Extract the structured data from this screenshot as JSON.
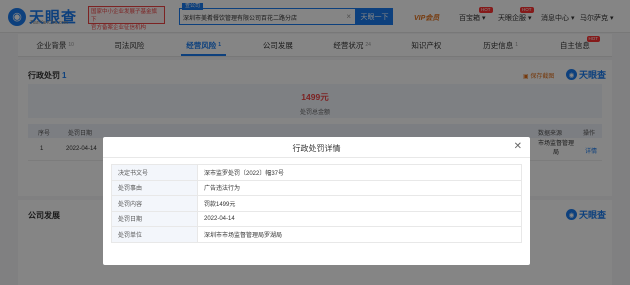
{
  "header": {
    "logo_text": "天眼查",
    "logo_url": "TianYanCha.com",
    "promo_line1": "国家中小企业发展子基金旗下",
    "promo_line2": "官方备案企业征信机构",
    "search_tag": "查公司",
    "search_value": "深圳市美肴餐饮管理有限公司百花二路分店",
    "search_button": "天眼一下",
    "vip_label": "VIP会员",
    "nav_app": "百宝箱",
    "nav_services": "天眼企服",
    "nav_messages": "消息中心",
    "nav_user": "马尔萨克",
    "hot": "HOT"
  },
  "tabs": [
    {
      "label": "企业背景",
      "count": "10"
    },
    {
      "label": "司法风险",
      "count": ""
    },
    {
      "label": "经营风险",
      "count": "1"
    },
    {
      "label": "公司发展",
      "count": ""
    },
    {
      "label": "经营状况",
      "count": "24"
    },
    {
      "label": "知识产权",
      "count": ""
    },
    {
      "label": "历史信息",
      "count": "1"
    },
    {
      "label": "自主信息",
      "count": ""
    }
  ],
  "penalty": {
    "title": "行政处罚",
    "count": "1",
    "save_label": "保存截图",
    "watermark": "天眼查",
    "total_amount": "1499元",
    "total_label": "处罚总金额",
    "columns": [
      "序号",
      "处罚日期",
      "数据来源",
      "操作"
    ],
    "row": {
      "index": "1",
      "date": "2022-04-14",
      "source": "市场监督管理局",
      "action": "详情"
    }
  },
  "development": {
    "title": "公司发展",
    "watermark": "天眼查"
  },
  "modal": {
    "title": "行政处罚详情",
    "close_icon": "close-icon",
    "rows": [
      {
        "label": "决定书文号",
        "value": "深市监罗处罚〔2022〕幅37号"
      },
      {
        "label": "处罚事由",
        "value": "广告违法行为"
      },
      {
        "label": "处罚内容",
        "value": "罚款1499元"
      },
      {
        "label": "处罚日期",
        "value": "2022-04-14"
      },
      {
        "label": "处罚单位",
        "value": "深圳市市场监督管理局罗湖局"
      }
    ]
  },
  "colors": {
    "brand": "#1a7cf0",
    "accent": "#e2701a",
    "danger": "#e44"
  }
}
